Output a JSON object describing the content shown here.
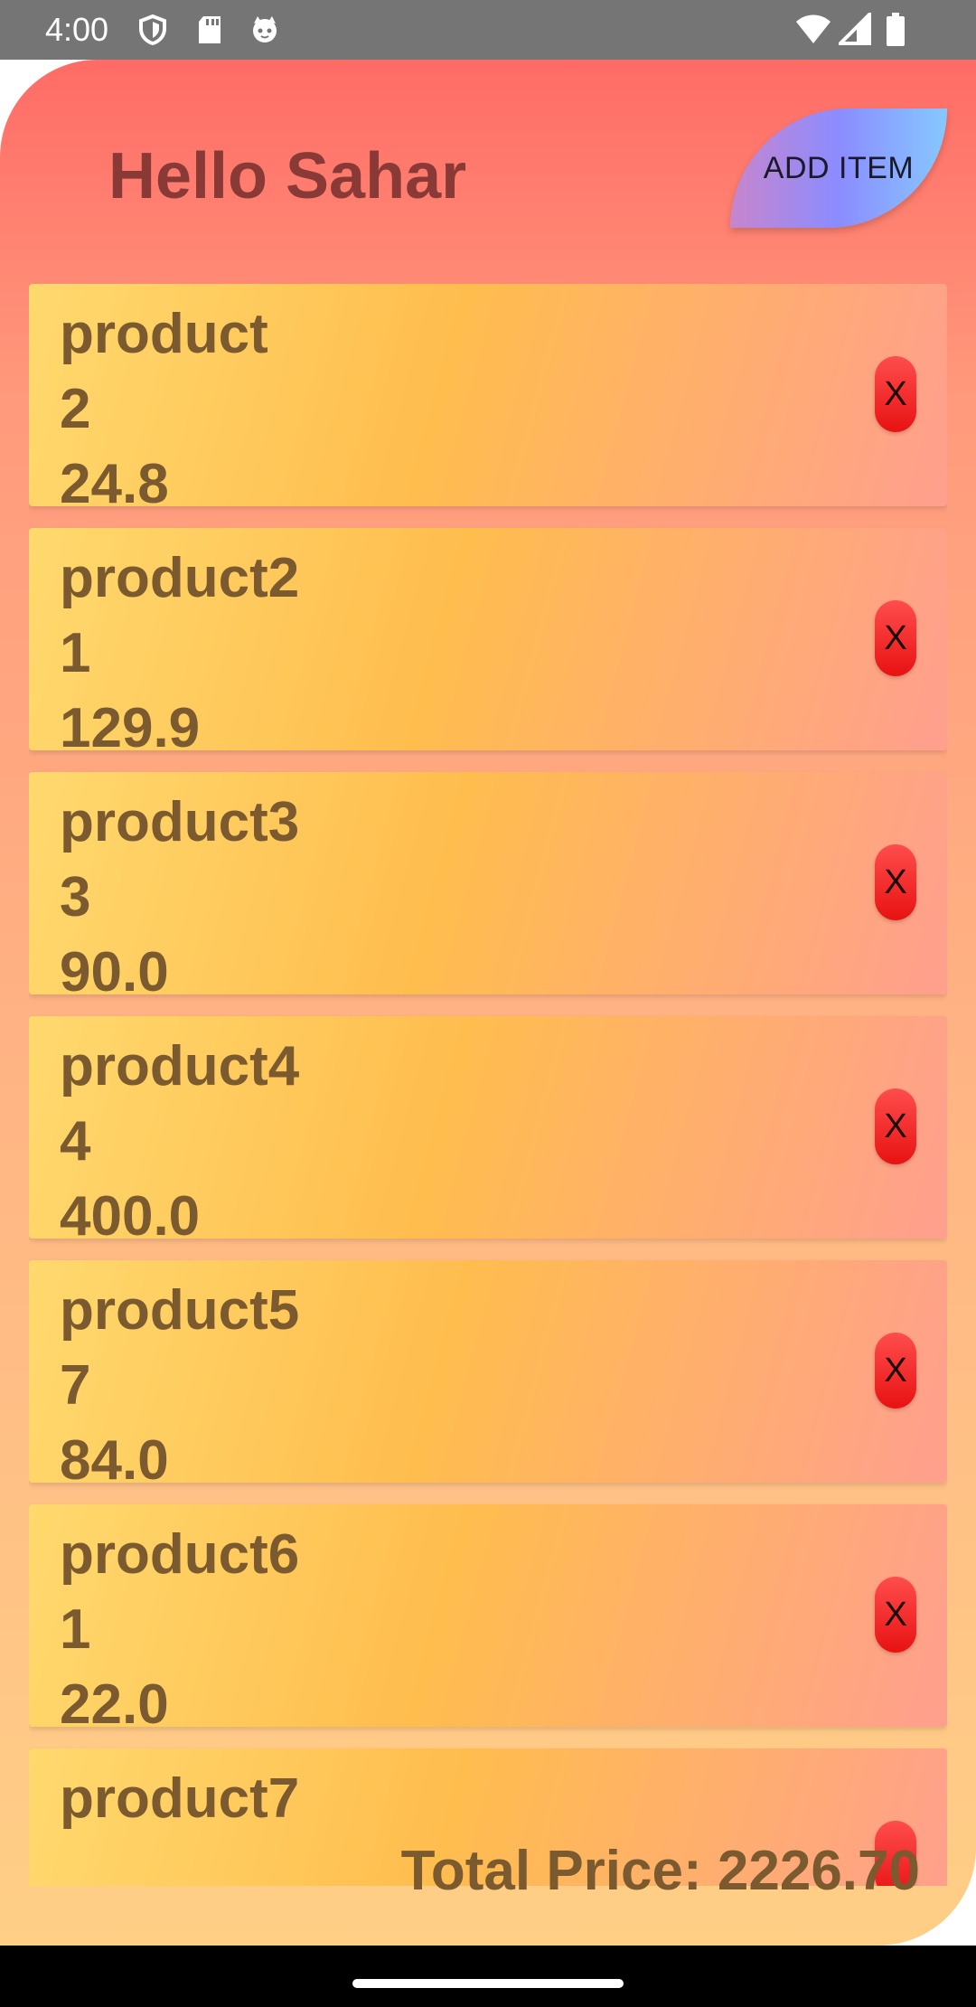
{
  "status_bar": {
    "time": "4:00",
    "left_icons": [
      "shield-icon",
      "sd-card-icon",
      "cat-face-icon"
    ],
    "right_icons": [
      "wifi-icon",
      "signal-icon",
      "battery-icon"
    ]
  },
  "header": {
    "greeting": "Hello Sahar",
    "add_button_label": "ADD ITEM"
  },
  "products": [
    {
      "name": "product",
      "quantity": "2",
      "price": "24.8",
      "delete_label": "X"
    },
    {
      "name": "product2",
      "quantity": "1",
      "price": "129.9",
      "delete_label": "X"
    },
    {
      "name": "product3",
      "quantity": "3",
      "price": "90.0",
      "delete_label": "X"
    },
    {
      "name": "product4",
      "quantity": "4",
      "price": "400.0",
      "delete_label": "X"
    },
    {
      "name": "product5",
      "quantity": "7",
      "price": "84.0",
      "delete_label": "X"
    },
    {
      "name": "product6",
      "quantity": "1",
      "price": "22.0",
      "delete_label": "X"
    },
    {
      "name": "product7",
      "quantity": "",
      "price": "",
      "delete_label": ""
    }
  ],
  "footer": {
    "total_label": "Total Price:",
    "total_value": "2226.70"
  },
  "colors": {
    "header_gradient_top": "#ff6b66",
    "card_gradient_start": "#ffd96e",
    "card_gradient_end": "#ff9f8e",
    "text_brown": "#7a5a2e",
    "delete_red": "#e81212",
    "add_button_gradient": [
      "#c785cc",
      "#8b8cff",
      "#86c8ff"
    ]
  }
}
